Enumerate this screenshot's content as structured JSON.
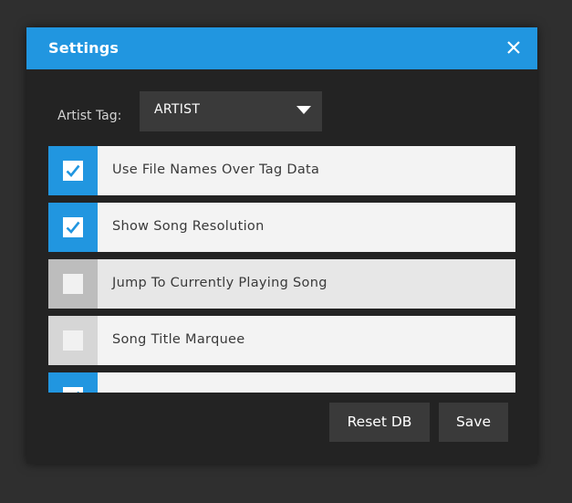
{
  "dialog": {
    "title": "Settings",
    "close_icon": "close-icon",
    "accent_color": "#2196e0"
  },
  "artist_tag": {
    "label": "Artist Tag:",
    "selected": "ARTIST"
  },
  "options": [
    {
      "label": "Use File Names Over Tag Data",
      "checked": true
    },
    {
      "label": "Show Song Resolution",
      "checked": true
    },
    {
      "label": "Jump To Currently Playing Song",
      "checked": false
    },
    {
      "label": "Song Title Marquee",
      "checked": false
    },
    {
      "label": "",
      "checked": true
    }
  ],
  "buttons": {
    "reset": "Reset DB",
    "save": "Save"
  }
}
